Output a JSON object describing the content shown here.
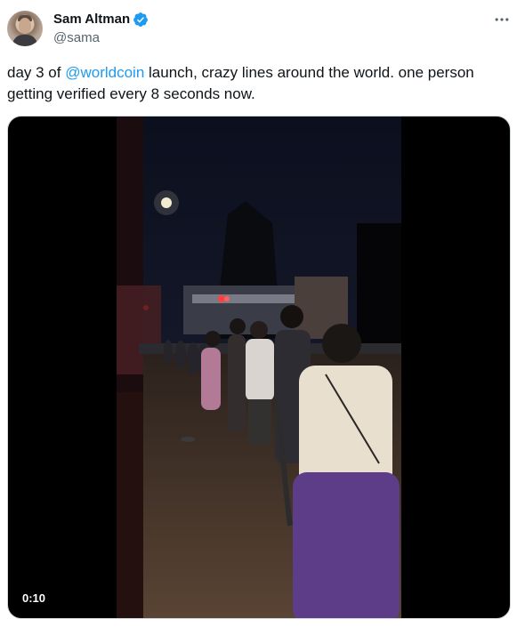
{
  "author": {
    "display_name": "Sam Altman",
    "handle": "@sama",
    "verified_icon": "verified-badge-icon",
    "avatar_icon": "profile-avatar"
  },
  "more_icon": "more-horizontal-icon",
  "tweet": {
    "text_before": "day 3 of ",
    "mention": "@worldcoin",
    "text_after": " launch, crazy lines around the world. one person getting verified every 8 seconds now."
  },
  "media": {
    "type": "video",
    "duration": "0:10"
  },
  "colors": {
    "accent": "#1d9bf0",
    "text": "#0f1419",
    "secondary_text": "#536471",
    "border": "#cfd9de"
  }
}
